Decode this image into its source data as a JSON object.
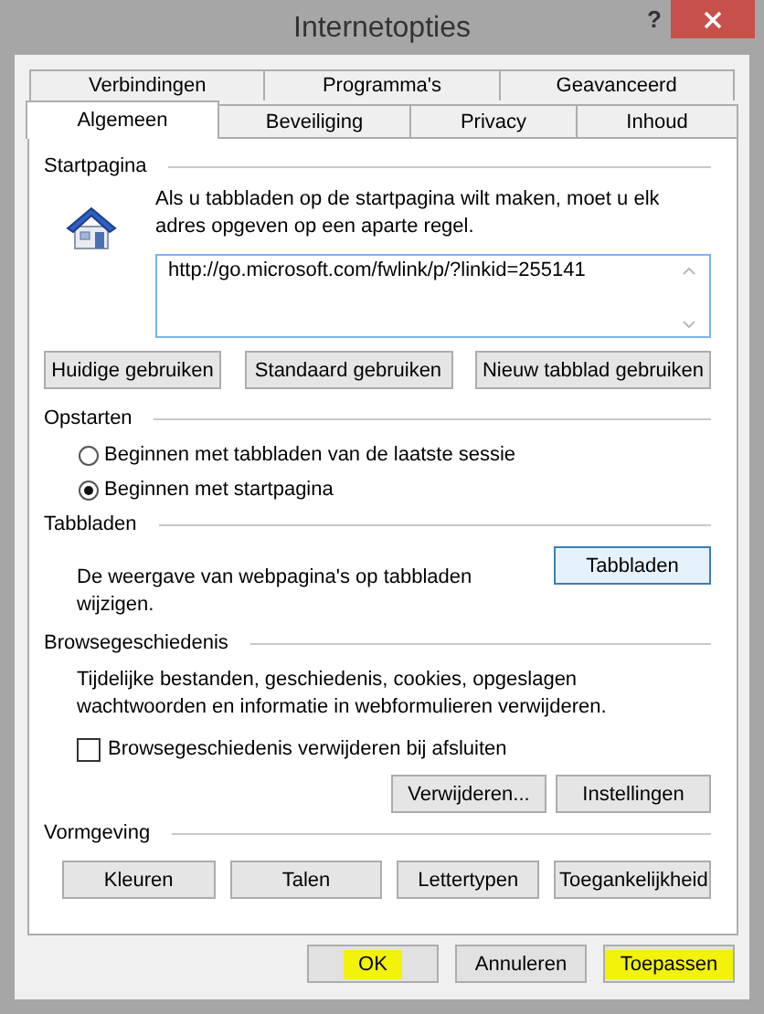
{
  "window": {
    "title": "Internetopties",
    "help": "?"
  },
  "tab_rows": [
    [
      {
        "label": "Verbindingen",
        "selected": false
      },
      {
        "label": "Programma's",
        "selected": false
      },
      {
        "label": "Geavanceerd",
        "selected": false
      }
    ],
    [
      {
        "label": "Algemeen",
        "selected": true
      },
      {
        "label": "Beveiliging",
        "selected": false
      },
      {
        "label": "Privacy",
        "selected": false
      },
      {
        "label": "Inhoud",
        "selected": false
      }
    ]
  ],
  "startpagina": {
    "heading": "Startpagina",
    "text": "Als u tabbladen op de startpagina wilt maken, moet u elk adres opgeven op een aparte regel.",
    "value": "http://go.microsoft.com/fwlink/p/?linkid=255141",
    "buttons": [
      "Huidige gebruiken",
      "Standaard gebruiken",
      "Nieuw tabblad gebruiken"
    ]
  },
  "opstarten": {
    "heading": "Opstarten",
    "options": [
      {
        "label": "Beginnen met tabbladen van de laatste sessie",
        "selected": false
      },
      {
        "label": "Beginnen met startpagina",
        "selected": true
      }
    ]
  },
  "tabbladen": {
    "heading": "Tabbladen",
    "text": "De weergave van webpagina's op tabbladen wijzigen.",
    "button": "Tabbladen"
  },
  "browsegeschiedenis": {
    "heading": "Browsegeschiedenis",
    "text": "Tijdelijke bestanden, geschiedenis, cookies, opgeslagen wachtwoorden en informatie in webformulieren verwijderen.",
    "checkbox": {
      "label": "Browsegeschiedenis verwijderen bij afsluiten",
      "checked": false
    },
    "buttons": [
      "Verwijderen...",
      "Instellingen"
    ]
  },
  "vormgeving": {
    "heading": "Vormgeving",
    "buttons": [
      "Kleuren",
      "Talen",
      "Lettertypen",
      "Toegankelijkheid"
    ]
  },
  "dialog_buttons": [
    {
      "label": "OK",
      "highlighted": true
    },
    {
      "label": "Annuleren",
      "highlighted": false
    },
    {
      "label": "Toepassen",
      "highlighted": true
    }
  ]
}
